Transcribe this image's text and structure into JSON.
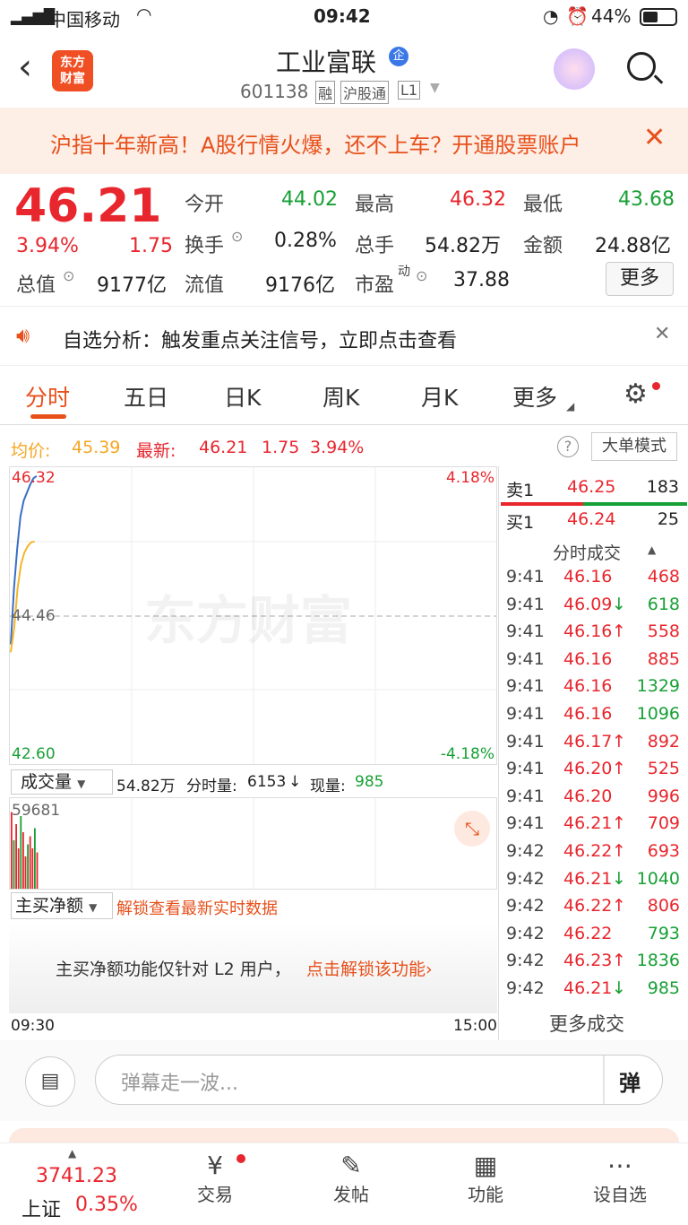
{
  "status": {
    "carrier": "中国移动",
    "time": "09:42",
    "battery": "44%"
  },
  "header": {
    "title": "工业富联",
    "badge": "企",
    "code": "601138",
    "tags": [
      "融",
      "沪股通",
      "L1"
    ],
    "logo": "东方\n财富"
  },
  "banner": {
    "text": "沪指十年新高！A股行情火爆，还不上车？开通股票账户"
  },
  "quote": {
    "price": "46.21",
    "pct": "3.94%",
    "chg": "1.75",
    "open_l": "今开",
    "open": "44.02",
    "high_l": "最高",
    "high": "46.32",
    "low_l": "最低",
    "low": "43.68",
    "turn_l": "换手",
    "turn": "0.28%",
    "vol_l": "总手",
    "vol": "54.82万",
    "amt_l": "金额",
    "amt": "24.88亿",
    "mcap_l": "总值",
    "mcap": "9177亿",
    "float_l": "流值",
    "float": "9176亿",
    "pe_l": "市盈",
    "pe_sup": "动",
    "pe": "37.88",
    "more": "更多"
  },
  "analysis": {
    "text": "自选分析：触发重点关注信号，立即点击查看"
  },
  "tabs": [
    "分时",
    "五日",
    "日K",
    "周K",
    "月K",
    "更多"
  ],
  "info": {
    "avg_l": "均价:",
    "avg": "45.39",
    "last_l": "最新:",
    "last": "46.21",
    "chg": "1.75",
    "pct": "3.94%",
    "mode": "大单模式"
  },
  "chart": {
    "top": "46.32",
    "mid": "44.46",
    "bottom": "42.60",
    "top_pct": "4.18%",
    "bot_pct": "-4.18%",
    "watermark": "东方财富",
    "price_line": [
      44.1,
      44.8,
      45.3,
      45.7,
      45.9,
      46.0,
      46.1,
      46.18,
      46.21
    ],
    "avg_line": [
      44.0,
      44.3,
      44.8,
      45.1,
      45.25,
      45.33,
      45.38,
      45.39
    ]
  },
  "vol": {
    "label": "成交量",
    "total": "54.82万",
    "min_l": "分时量:",
    "min": "6153",
    "now_l": "现量:",
    "now": "985",
    "max": "59681"
  },
  "mainbuy": {
    "label": "主买净额",
    "unlock": "解锁查看最新实时数据",
    "desc": "主买净额功能仅针对 L2 用户，",
    "link": "点击解锁该功能"
  },
  "times": {
    "start": "09:30",
    "end": "15:00"
  },
  "book": {
    "sell_l": "卖1",
    "sell_p": "46.25",
    "sell_v": "183",
    "buy_l": "买1",
    "buy_p": "46.24",
    "buy_v": "25",
    "title": "分时成交",
    "more": "更多成交",
    "trades": [
      {
        "t": "9:41",
        "p": "46.16",
        "a": "",
        "v": "468",
        "c": "red"
      },
      {
        "t": "9:41",
        "p": "46.09",
        "a": "↓",
        "v": "618",
        "c": "green"
      },
      {
        "t": "9:41",
        "p": "46.16",
        "a": "↑",
        "v": "558",
        "c": "red"
      },
      {
        "t": "9:41",
        "p": "46.16",
        "a": "",
        "v": "885",
        "c": "red"
      },
      {
        "t": "9:41",
        "p": "46.16",
        "a": "",
        "v": "1329",
        "c": "green"
      },
      {
        "t": "9:41",
        "p": "46.16",
        "a": "",
        "v": "1096",
        "c": "green"
      },
      {
        "t": "9:41",
        "p": "46.17",
        "a": "↑",
        "v": "892",
        "c": "red"
      },
      {
        "t": "9:41",
        "p": "46.20",
        "a": "↑",
        "v": "525",
        "c": "red"
      },
      {
        "t": "9:41",
        "p": "46.20",
        "a": "",
        "v": "996",
        "c": "red"
      },
      {
        "t": "9:41",
        "p": "46.21",
        "a": "↑",
        "v": "709",
        "c": "red"
      },
      {
        "t": "9:42",
        "p": "46.22",
        "a": "↑",
        "v": "693",
        "c": "red"
      },
      {
        "t": "9:42",
        "p": "46.21",
        "a": "↓",
        "v": "1040",
        "c": "green"
      },
      {
        "t": "9:42",
        "p": "46.22",
        "a": "↑",
        "v": "806",
        "c": "red"
      },
      {
        "t": "9:42",
        "p": "46.22",
        "a": "",
        "v": "793",
        "c": "green"
      },
      {
        "t": "9:42",
        "p": "46.23",
        "a": "↑",
        "v": "1836",
        "c": "green"
      },
      {
        "t": "9:42",
        "p": "46.21",
        "a": "↓",
        "v": "985",
        "c": "green"
      }
    ]
  },
  "comment": {
    "placeholder": "弹幕走一波...",
    "btn": "弹"
  },
  "nav": {
    "index_val": "3741.23",
    "index_name": "上证",
    "index_pct": "0.35%",
    "items": [
      "交易",
      "发帖",
      "功能",
      "设自选"
    ]
  }
}
